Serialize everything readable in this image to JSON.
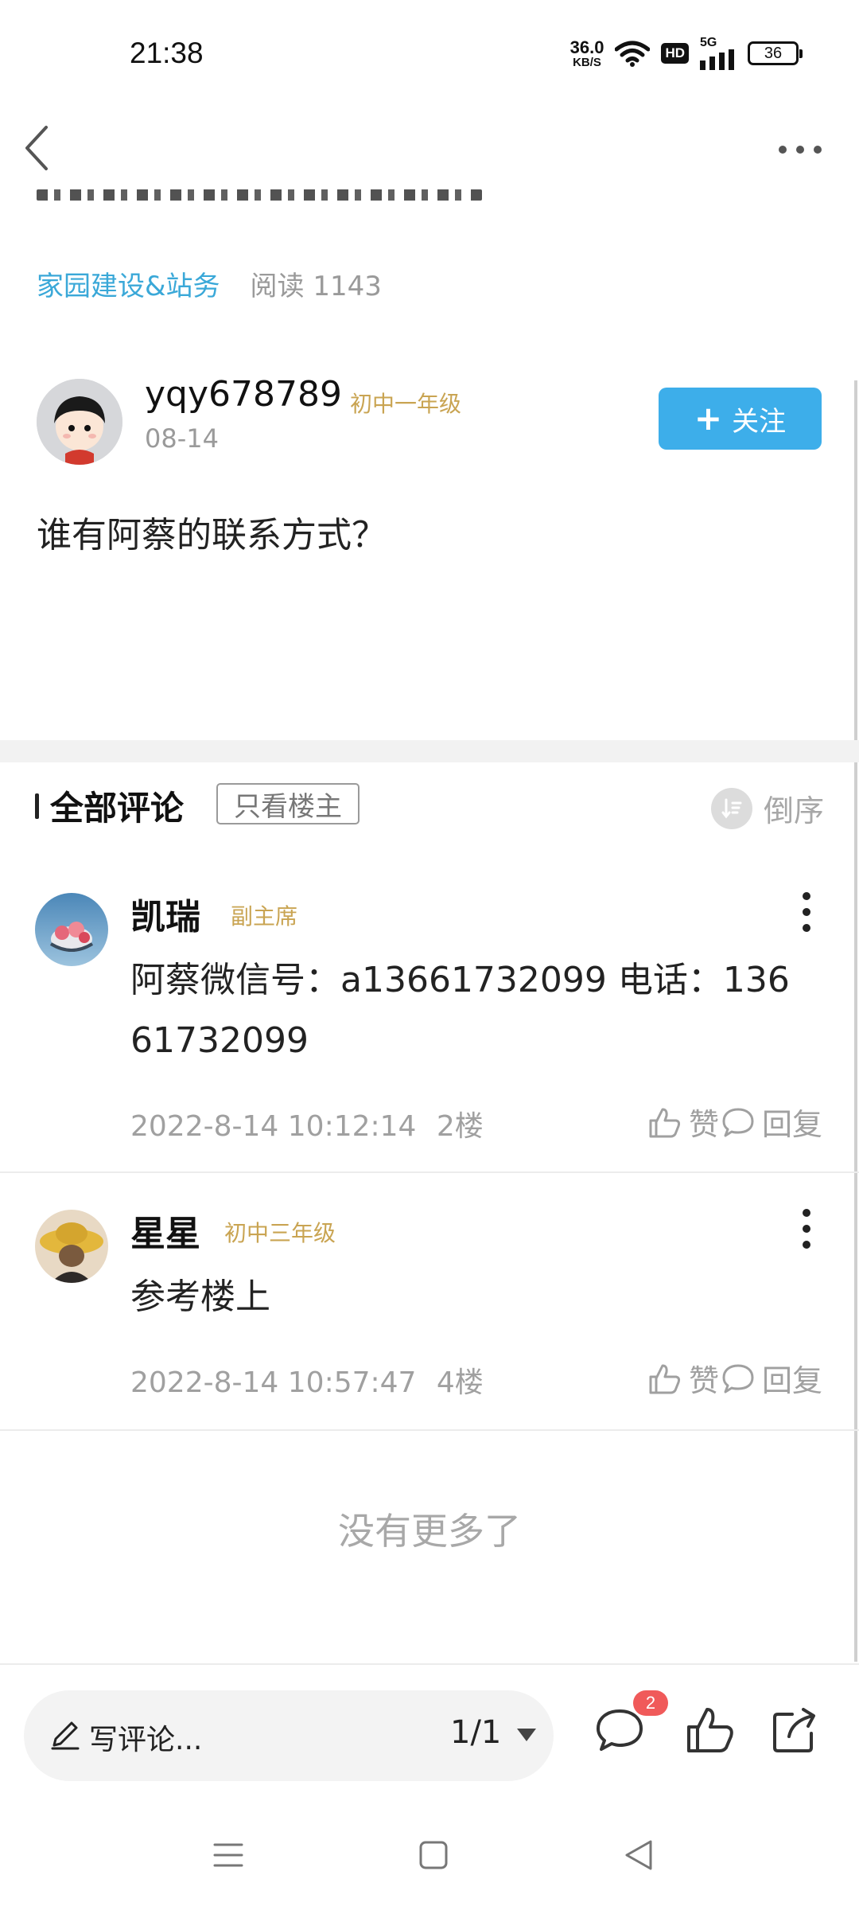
{
  "status_bar": {
    "time": "21:38",
    "net_speed_value": "36.0",
    "net_speed_unit": "KB/S",
    "hd_label": "HD",
    "network_label": "5G",
    "battery_level": "36"
  },
  "header": {
    "back_icon": "chevron-left-icon",
    "more_icon": "more-horizontal-icon"
  },
  "post": {
    "topic": "家园建设&站务",
    "read_count": "阅读 1143",
    "author": {
      "name": "yqy678789",
      "grade": "初中一年级",
      "date": "08-14"
    },
    "follow_label": "关注",
    "body": "谁有阿蔡的联系方式？"
  },
  "comments_section": {
    "title": "全部评论",
    "only_op_label": "只看楼主",
    "sort_label": "倒序",
    "items": [
      {
        "name": "凯瑞",
        "role": "副主席",
        "text": "阿蔡微信号：a13661732099 电话：136",
        "text_line2": "61732099",
        "timestamp": "2022-8-14 10:12:14",
        "floor": "2楼",
        "like_label": "赞",
        "reply_label": "回复"
      },
      {
        "name": "星星",
        "role": "初中三年级",
        "text": "参考楼上",
        "timestamp": "2022-8-14 10:57:47",
        "floor": "4楼",
        "like_label": "赞",
        "reply_label": "回复"
      }
    ],
    "no_more": "没有更多了"
  },
  "bottom_bar": {
    "input_placeholder": "写评论...",
    "page_indicator": "1/1",
    "comment_count_badge": "2"
  },
  "colors": {
    "accent_blue": "#3daeea",
    "topic_link": "#3aa8d8",
    "grade_gold": "#c9a452",
    "badge_red": "#f05a5a"
  }
}
